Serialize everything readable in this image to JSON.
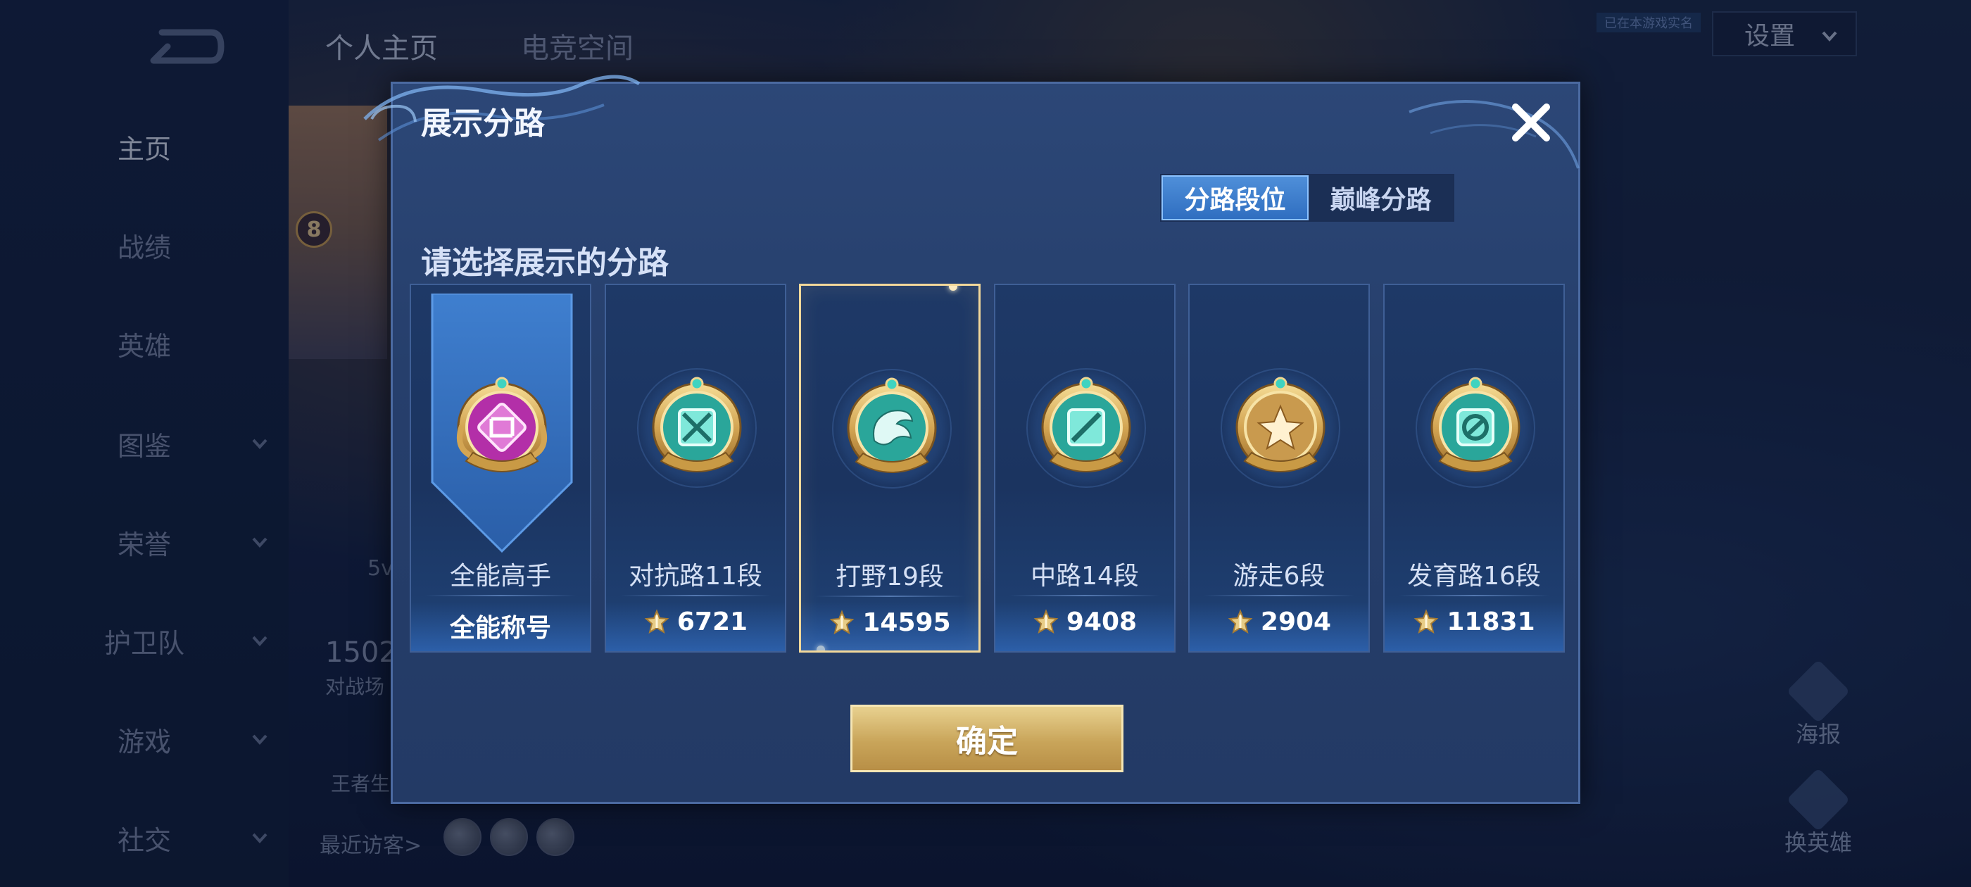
{
  "background": {
    "sidebar": {
      "items": [
        {
          "label": "主页",
          "active": true,
          "has_chevron": false
        },
        {
          "label": "战绩",
          "active": false,
          "has_chevron": false
        },
        {
          "label": "英雄",
          "active": false,
          "has_chevron": false
        },
        {
          "label": "图鉴",
          "active": false,
          "has_chevron": true
        },
        {
          "label": "荣誉",
          "active": false,
          "has_chevron": true
        },
        {
          "label": "护卫队",
          "active": false,
          "has_chevron": true
        },
        {
          "label": "游戏",
          "active": false,
          "has_chevron": true
        },
        {
          "label": "社交",
          "active": false,
          "has_chevron": true
        }
      ]
    },
    "tabs": [
      "个人主页",
      "电竞空间"
    ],
    "active_tab": "个人主页",
    "settings_label": "设置",
    "top_badge": "已在本游戏实名",
    "level": "8",
    "stats_number": "1502",
    "stats_label": "对战场",
    "stats_5v": "5v",
    "king_label": "王者生",
    "recent_visitors_label": "最近访客>",
    "right_icons": [
      {
        "label": "海报",
        "icon": "poster-icon"
      },
      {
        "label": "换英雄",
        "icon": "switch-hero-icon"
      }
    ]
  },
  "modal": {
    "title": "展示分路",
    "close_icon": "close-icon",
    "segments": [
      {
        "label": "分路段位",
        "active": true
      },
      {
        "label": "巅峰分路",
        "active": false
      }
    ],
    "subtitle": "请选择展示的分路",
    "cards": [
      {
        "lane": "全能高手",
        "value_text": "全能称号",
        "show_icon": false,
        "medal": "all-round",
        "selected": false
      },
      {
        "lane": "对抗路11段",
        "value_text": "6721",
        "show_icon": true,
        "medal": "clash",
        "selected": false
      },
      {
        "lane": "打野19段",
        "value_text": "14595",
        "show_icon": true,
        "medal": "jungle",
        "selected": true
      },
      {
        "lane": "中路14段",
        "value_text": "9408",
        "show_icon": true,
        "medal": "mid",
        "selected": false
      },
      {
        "lane": "游走6段",
        "value_text": "2904",
        "show_icon": true,
        "medal": "roam",
        "selected": false
      },
      {
        "lane": "发育路16段",
        "value_text": "11831",
        "show_icon": true,
        "medal": "farm",
        "selected": false
      }
    ],
    "confirm_label": "确定"
  },
  "colors": {
    "modal_bg": "#2a4574",
    "accent_blue": "#3a7ccc",
    "gold": "#d9b56a",
    "selected_border": "#f3d89a"
  }
}
